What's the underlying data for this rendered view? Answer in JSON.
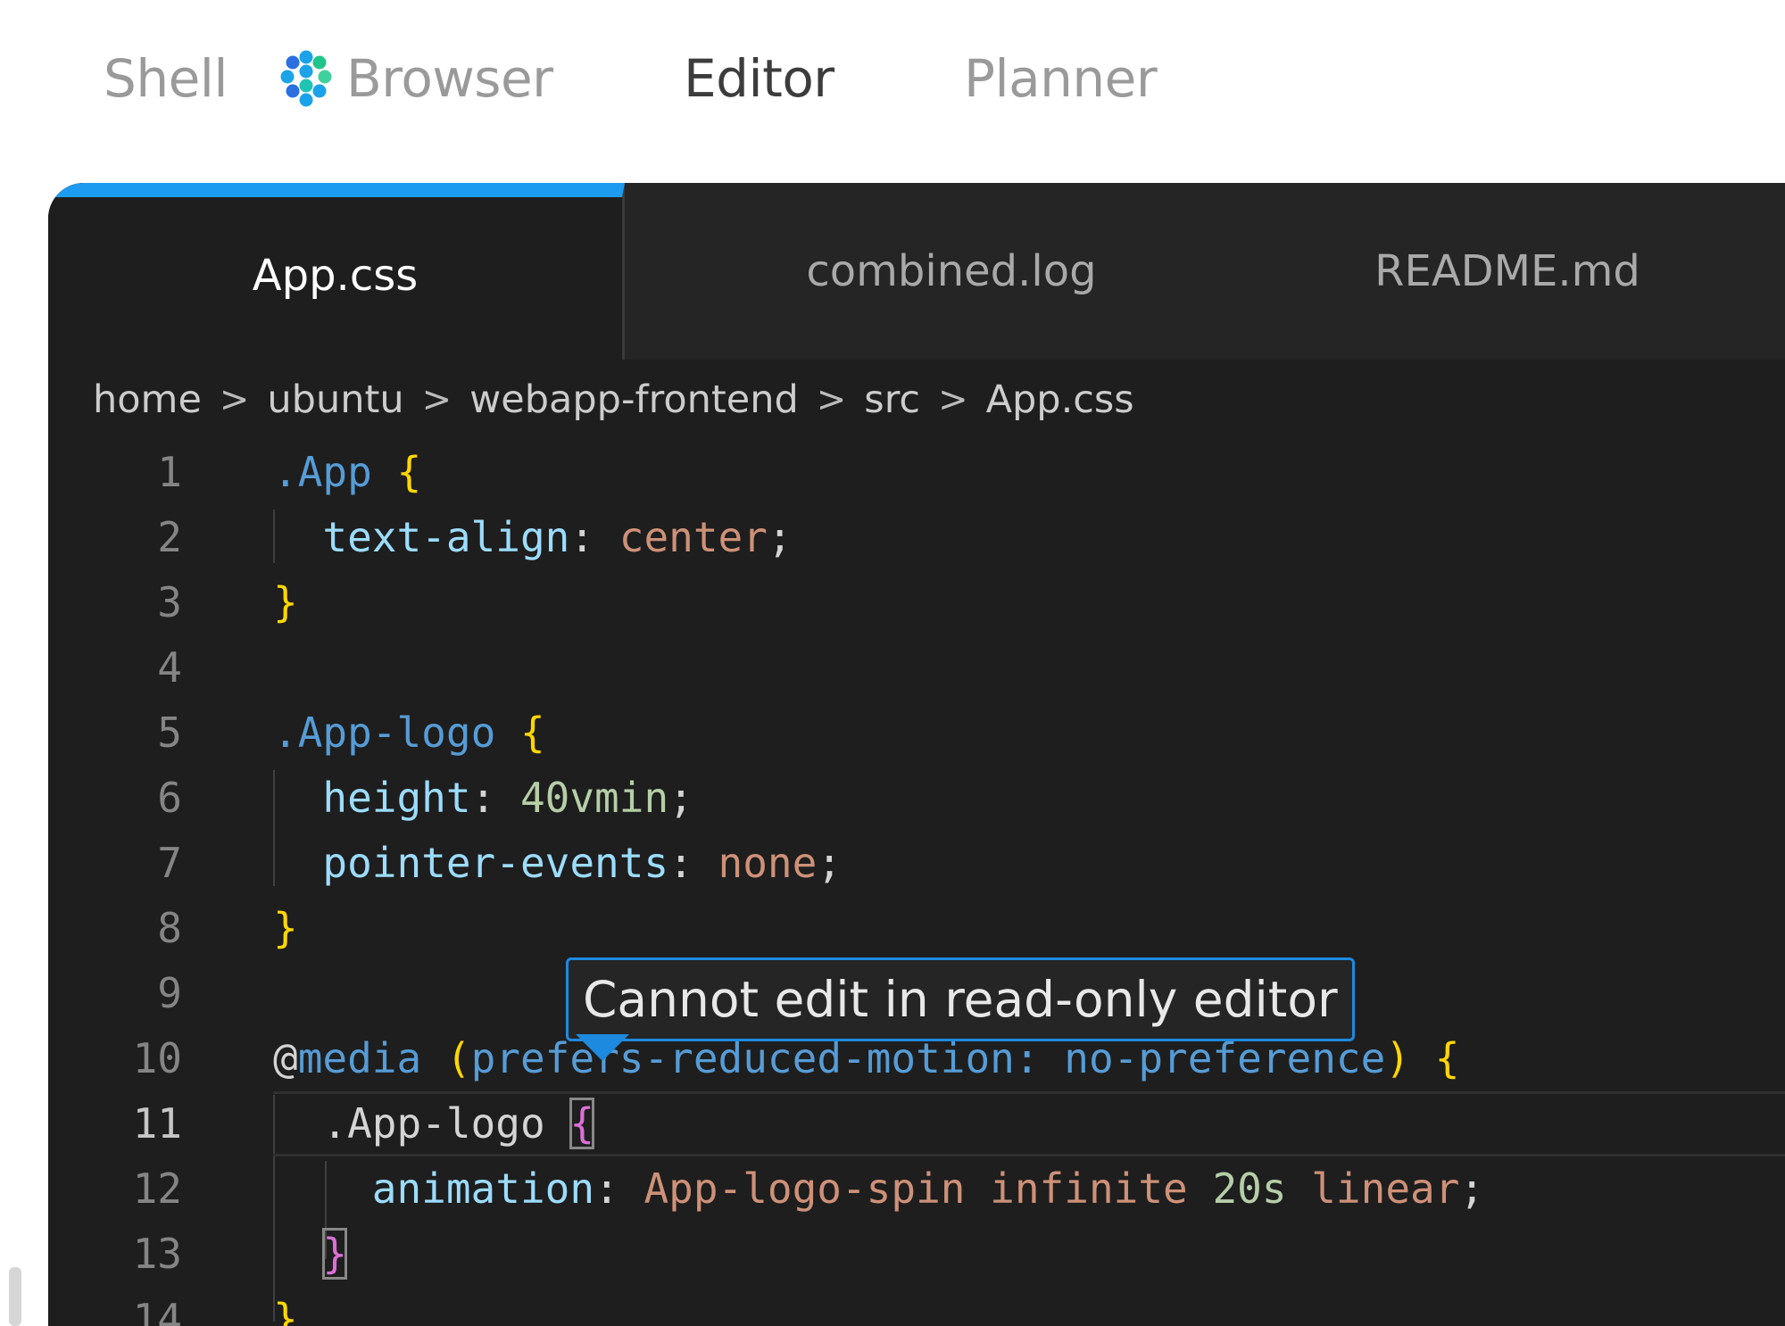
{
  "app_tabs": {
    "shell": "Shell",
    "browser": "Browser",
    "editor": "Editor",
    "planner": "Planner"
  },
  "file_tabs": [
    "App.css",
    "combined.log",
    "README.md"
  ],
  "breadcrumb": [
    "home",
    "ubuntu",
    "webapp-frontend",
    "src",
    "App.css"
  ],
  "breadcrumb_separator": ">",
  "line_numbers": [
    "1",
    "2",
    "3",
    "4",
    "5",
    "6",
    "7",
    "8",
    "9",
    "10",
    "11",
    "12",
    "13",
    "14"
  ],
  "code": {
    "l1": [
      ".",
      "App",
      " ",
      "{"
    ],
    "l2": [
      "text-align",
      ":",
      " ",
      "center",
      ";"
    ],
    "l3": [
      "}"
    ],
    "l5": [
      ".",
      "App-logo",
      " ",
      "{"
    ],
    "l6": [
      "height",
      ":",
      " ",
      "40vmin",
      ";"
    ],
    "l7": [
      "pointer-events",
      ":",
      " ",
      "none",
      ";"
    ],
    "l8": [
      "}"
    ],
    "l10": [
      "@",
      "media",
      " ",
      "(",
      "prefers-reduced-motion: no-preference",
      ")",
      " ",
      "{"
    ],
    "l11": [
      ".App-logo",
      " ",
      "{"
    ],
    "l12": [
      "animation",
      ":",
      " ",
      "App-logo-spin",
      " ",
      "infinite",
      " ",
      "20s",
      " ",
      "linear",
      ";"
    ],
    "l13": [
      "}"
    ],
    "l14": [
      "}"
    ]
  },
  "current_line": "11",
  "tooltip": "Cannot edit in read-only editor",
  "colors": {
    "active_tab_accent": "#1d9bf0",
    "tooltip_border": "#1d8ae0",
    "editor_bg": "#1e1e1e"
  }
}
